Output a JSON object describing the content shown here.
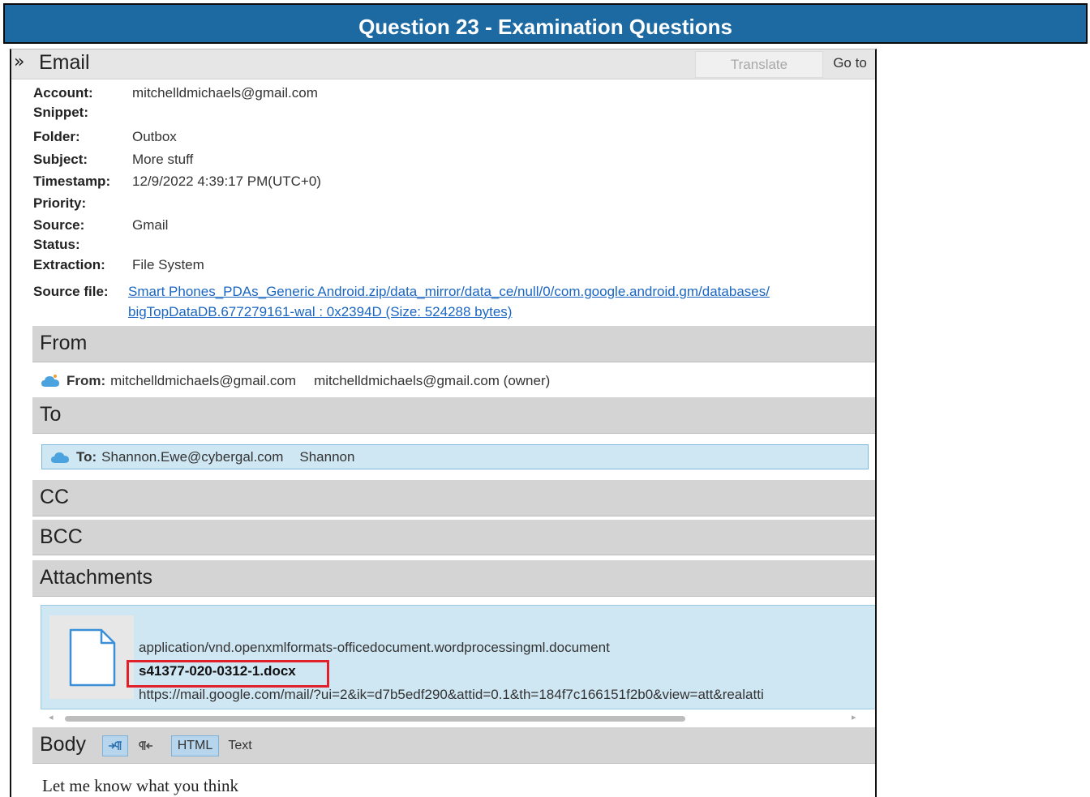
{
  "banner": {
    "title": "Question 23 - Examination Questions"
  },
  "window": {
    "title": "Email",
    "translate_label": "Translate",
    "goto_label": "Go to"
  },
  "fields": {
    "account_label": "Account:",
    "account_value": "mitchelldmichaels@gmail.com",
    "snippet_label": "Snippet:",
    "folder_label": "Folder:",
    "folder_value": "Outbox",
    "subject_label": "Subject:",
    "subject_value": "More stuff",
    "timestamp_label": "Timestamp:",
    "timestamp_value": "12/9/2022 4:39:17 PM(UTC+0)",
    "priority_label": "Priority:",
    "source_label": "Source:",
    "source_value": "Gmail",
    "status_label": "Status:",
    "extraction_label": "Extraction:",
    "extraction_value": "File System",
    "sourcefile_label": "Source file:",
    "sourcefile_line1": "Smart Phones_PDAs_Generic Android.zip/data_mirror/data_ce/null/0/com.google.android.gm/databases/",
    "sourcefile_line2": "bigTopDataDB.677279161-wal : 0x2394D (Size: 524288 bytes)"
  },
  "from": {
    "heading": "From",
    "label": "From:",
    "address": "mitchelldmichaels@gmail.com",
    "display": "mitchelldmichaels@gmail.com (owner)"
  },
  "to": {
    "heading": "To",
    "label": "To:",
    "address": "Shannon.Ewe@cybergal.com",
    "display": "Shannon"
  },
  "cc": {
    "heading": "CC"
  },
  "bcc": {
    "heading": "BCC"
  },
  "attachments": {
    "heading": "Attachments",
    "mime": "application/vnd.openxmlformats-officedocument.wordprocessingml.document",
    "filename": "s41377-020-0312-1.docx",
    "url": "https://mail.google.com/mail/?ui=2&ik=d7b5edf290&attid=0.1&th=184f7c166151f2b0&view=att&realatti"
  },
  "body": {
    "heading": "Body",
    "html_label": "HTML",
    "text_label": "Text",
    "content": "Let me know what you think"
  },
  "colors": {
    "banner": "#1d6aa3",
    "highlight": "#e0202a",
    "selected_bg": "#cfe6f3",
    "link": "#1a66c2"
  },
  "icons": [
    "double-chevron-icon",
    "cloud-contact-icon",
    "document-icon",
    "ltr-paragraph-icon",
    "rtl-paragraph-icon"
  ]
}
